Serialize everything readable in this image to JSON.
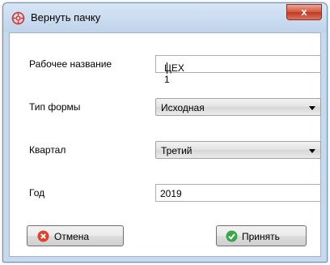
{
  "window": {
    "title": "Вернуть пачку",
    "close_label": "x"
  },
  "form": {
    "work_name_label": "Рабочее название",
    "work_name_value": "ЦЕХ 1",
    "form_type_label": "Тип формы",
    "form_type_value": "Исходная",
    "quarter_label": "Квартал",
    "quarter_value": "Третий",
    "year_label": "Год",
    "year_value": "2019"
  },
  "buttons": {
    "cancel_label": "Отмена",
    "accept_label": "Принять"
  },
  "colors": {
    "cancel_icon": "#e0422b",
    "accept_icon": "#3aa64a",
    "app_icon": "#d0342c"
  }
}
